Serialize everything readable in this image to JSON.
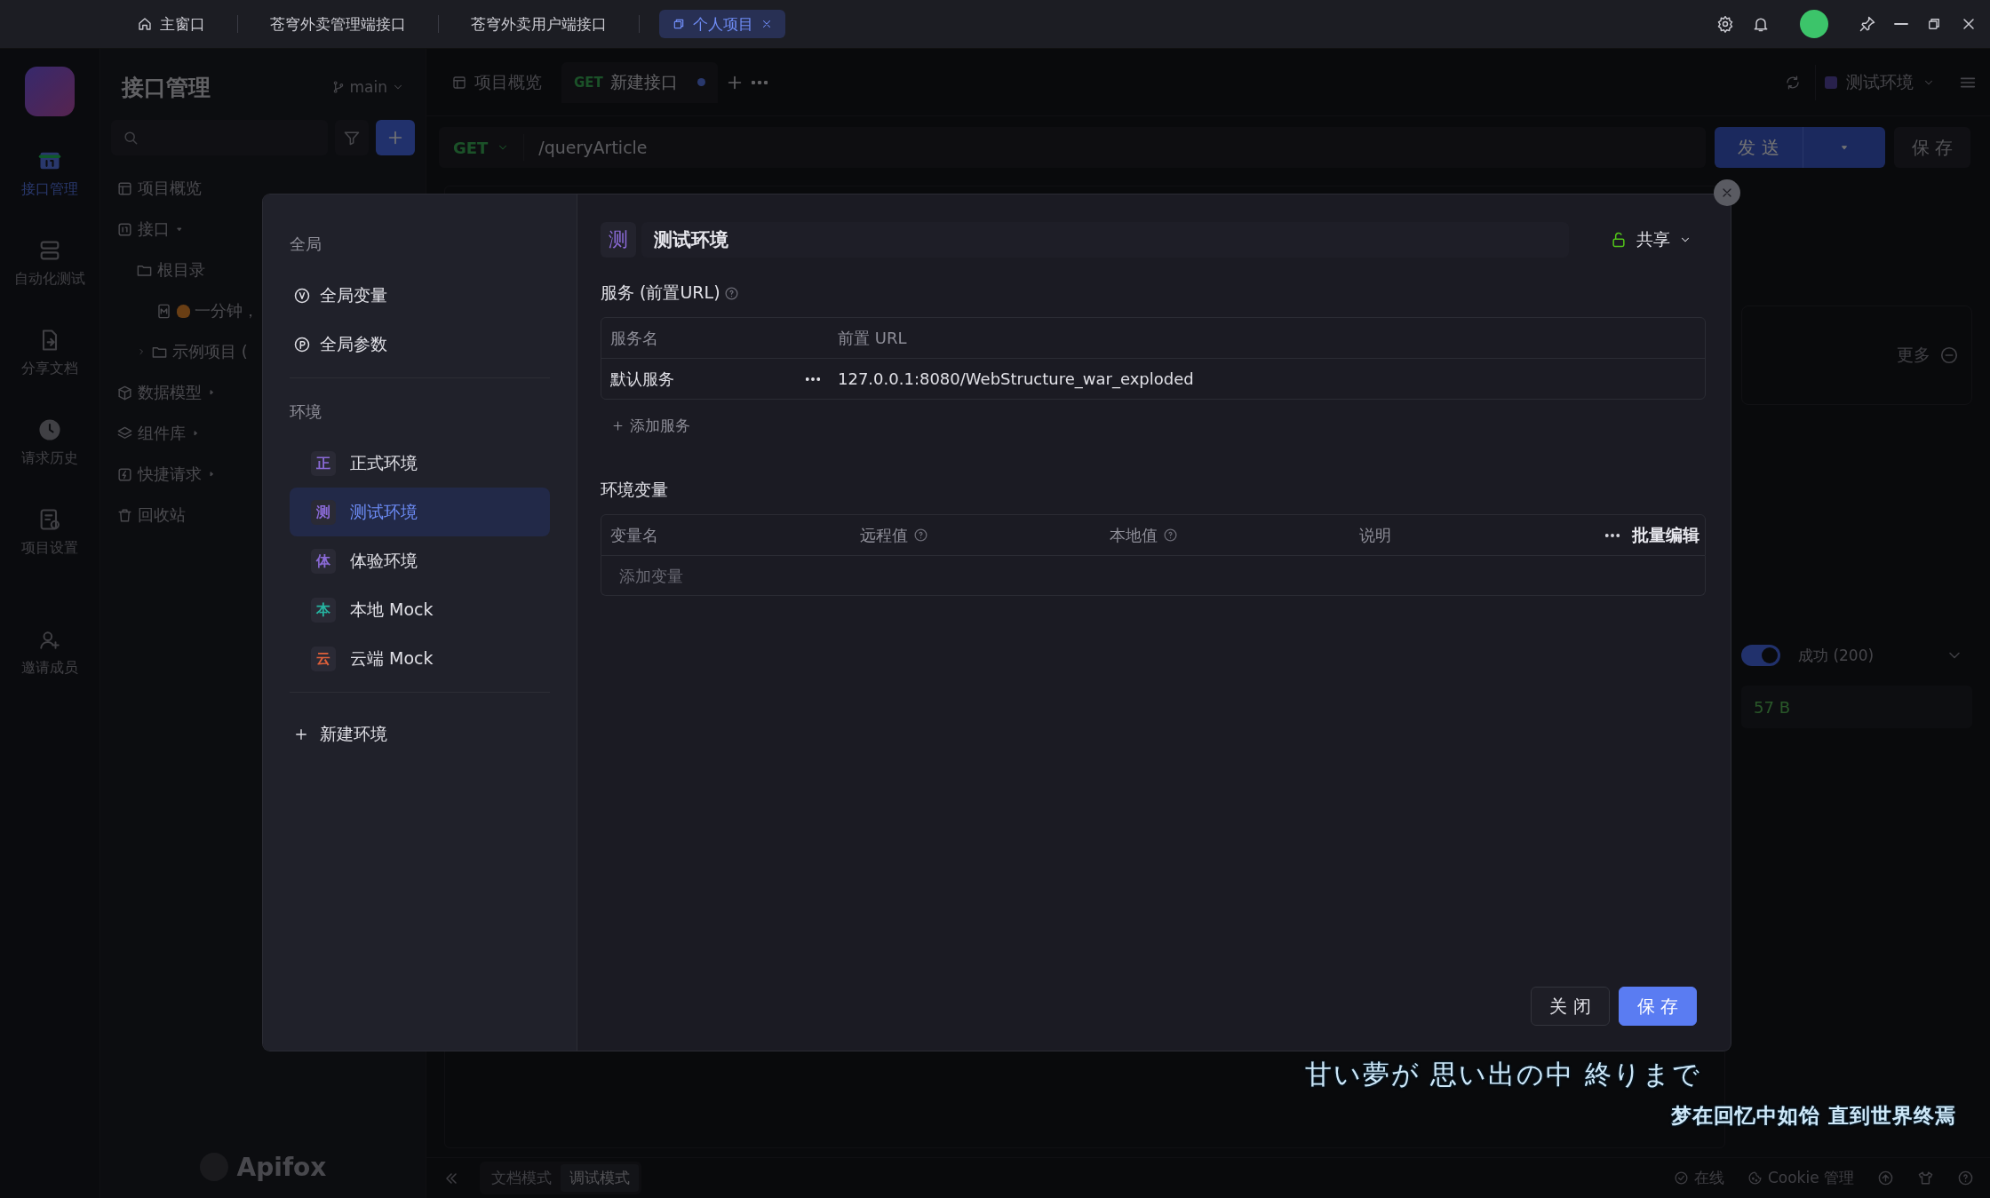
{
  "title_bar": {
    "tabs": [
      {
        "label": "主窗口",
        "kind": "home",
        "selected": false,
        "closable": false
      },
      {
        "label": "苍穹外卖管理端接口",
        "kind": "plain",
        "selected": false,
        "closable": false
      },
      {
        "label": "苍穹外卖用户端接口",
        "kind": "plain",
        "selected": false,
        "closable": false
      },
      {
        "label": "个人项目",
        "kind": "project",
        "selected": true,
        "closable": true
      }
    ]
  },
  "rail": {
    "items": [
      {
        "label": "接口管理",
        "kind": "api",
        "selected": true
      },
      {
        "label": "自动化测试",
        "kind": "auto",
        "selected": false
      },
      {
        "label": "分享文档",
        "kind": "share",
        "selected": false
      },
      {
        "label": "请求历史",
        "kind": "history",
        "selected": false
      },
      {
        "label": "项目设置",
        "kind": "settings",
        "selected": false
      }
    ],
    "invite": "邀请成员"
  },
  "sidebar": {
    "title": "接口管理",
    "branch": "main",
    "tree": [
      {
        "label": "项目概览",
        "kind": "overview"
      },
      {
        "label": "接口",
        "kind": "api",
        "expanded": true,
        "children": [
          {
            "label": "根目录",
            "kind": "folder",
            "children": [
              {
                "label": "一分钟，",
                "kind": "markdown"
              }
            ]
          },
          {
            "label": "示例项目 (",
            "kind": "folder",
            "expanded": false
          }
        ]
      },
      {
        "label": "数据模型",
        "kind": "model",
        "expanded": false
      },
      {
        "label": "组件库",
        "kind": "components",
        "expanded": false
      },
      {
        "label": "快捷请求",
        "kind": "quick",
        "expanded": false
      },
      {
        "label": "回收站",
        "kind": "trash"
      }
    ],
    "brand": "Apifox"
  },
  "main": {
    "tabs": [
      {
        "label": "项目概览",
        "selected": false,
        "unsaved": false
      },
      {
        "method": "GET",
        "label": "新建接口",
        "selected": true,
        "unsaved": true
      }
    ],
    "environment": "测试环境",
    "request": {
      "method": "GET",
      "url": "/queryArticle",
      "send": "发 送",
      "save": "保 存"
    },
    "response": {
      "more": "更多",
      "switch_on": true,
      "status": "成功 (200)",
      "size": "57 B"
    },
    "modes": [
      {
        "label": "文档模式",
        "selected": false
      },
      {
        "label": "调试模式",
        "selected": true
      }
    ],
    "status": "在线",
    "cookie": "Cookie 管理"
  },
  "modal": {
    "global_heading": "全局",
    "global_items": [
      {
        "label": "全局变量",
        "kind": "variables"
      },
      {
        "label": "全局参数",
        "kind": "params"
      }
    ],
    "env_heading": "环境",
    "environments": [
      {
        "badge": "正",
        "label": "正式环境",
        "color": "#8a6ad6",
        "selected": false
      },
      {
        "badge": "测",
        "label": "测试环境",
        "color": "#8a6ad6",
        "selected": true
      },
      {
        "badge": "体",
        "label": "体验环境",
        "color": "#8a6ad6",
        "selected": false
      },
      {
        "badge": "本",
        "label": "本地 Mock",
        "color": "#26b3a0",
        "selected": false
      },
      {
        "badge": "云",
        "label": "云端 Mock",
        "color": "#e0603a",
        "selected": false
      }
    ],
    "new_env": "新建环境",
    "detail": {
      "badge": "测",
      "name": "测试环境",
      "share": "共享",
      "services_heading": "服务 (前置URL)",
      "service_columns": [
        "服务名",
        "前置 URL"
      ],
      "services": [
        {
          "name": "默认服务",
          "url": "127.0.0.1:8080/WebStructure_war_exploded"
        }
      ],
      "add_service": "添加服务",
      "vars_heading": "环境变量",
      "var_columns": [
        {
          "label": "变量名",
          "help": false
        },
        {
          "label": "远程值",
          "help": true
        },
        {
          "label": "本地值",
          "help": true
        },
        {
          "label": "说明",
          "help": false
        }
      ],
      "bulk_edit": "批量编辑",
      "add_var_placeholder": "添加变量"
    },
    "buttons": {
      "close": "关 闭",
      "save": "保 存"
    }
  },
  "lyrics": [
    "甘い夢が 思い出の中 終りまで",
    "梦在回忆中如饴 直到世界终焉"
  ]
}
